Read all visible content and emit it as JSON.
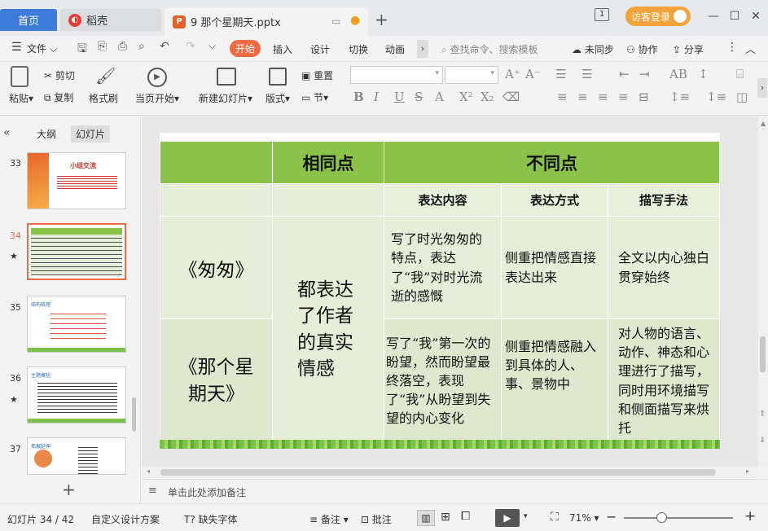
{
  "tabs": {
    "home": "首页",
    "daoke": "稻壳",
    "doc": "9 那个星期天.pptx"
  },
  "visitor": "访客登录",
  "menu": {
    "file": "文件",
    "items": [
      "开始",
      "插入",
      "设计",
      "切换",
      "动画"
    ],
    "search": "查找命令、搜索模板",
    "sync": "未同步",
    "collab": "协作",
    "share": "分享"
  },
  "ribbon": {
    "paste": "粘贴",
    "cut": "剪切",
    "copy": "复制",
    "format_painter": "格式刷",
    "play": "当页开始",
    "new_slide": "新建幻灯片",
    "layout": "版式",
    "reset": "重置",
    "section": "节"
  },
  "panel": {
    "outline": "大纲",
    "slides": "幻灯片",
    "thumbs": [
      {
        "num": "33",
        "title": "小组交流"
      },
      {
        "num": "34"
      },
      {
        "num": "35",
        "title": "结构梳理"
      },
      {
        "num": "36",
        "title": "主题概括"
      },
      {
        "num": "37",
        "title": "拓展延伸"
      }
    ]
  },
  "table": {
    "h_same": "相同点",
    "h_diff": "不同点",
    "sub1": "表达内容",
    "sub2": "表达方式",
    "sub3": "描写手法",
    "r1_title": "《匆匆》",
    "r2_title": "《那个星期天》",
    "same": "都表达了作者的真实情感",
    "r1c1": "写了时光匆匆的特点，表达了“我”对时光流逝的感慨",
    "r1c2": "侧重把情感直接表达出来",
    "r1c3": "全文以内心独白贯穿始终",
    "r2c1": "写了“我”第一次的盼望，然而盼望最终落空，表现了“我”从盼望到失望的内心变化",
    "r2c2": "侧重把情感融入到具体的人、事、景物中",
    "r2c3": "对人物的语言、动作、神态和心理进行了描写，同时用环境描写和侧面描写来烘托"
  },
  "notes": "单击此处添加备注",
  "status": {
    "slide": "幻灯片 34 / 42",
    "design": "自定义设计方案",
    "font": "缺失字体",
    "remark": "备注",
    "comment": "批注",
    "zoom": "71%"
  }
}
